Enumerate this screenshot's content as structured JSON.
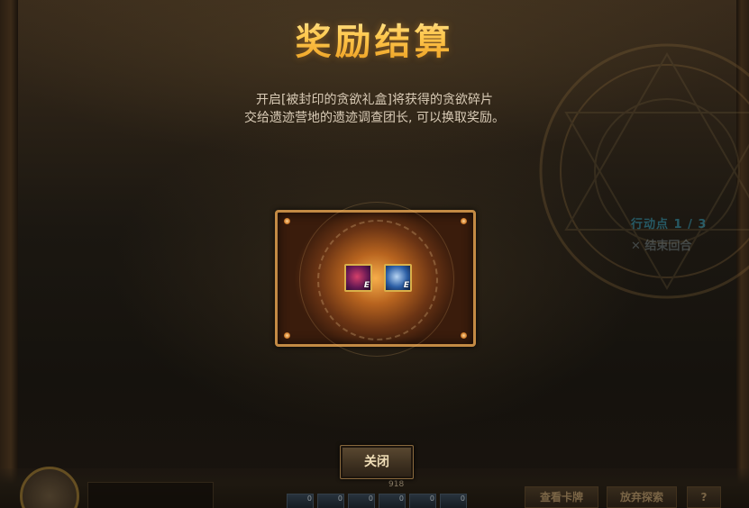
{
  "title": "奖励结算",
  "description": {
    "line1": "开启[被封印的贪欲礼盒]将获得的贪欲碎片",
    "line2": "交给遗迹营地的遗迹调查团长, 可以换取奖励。"
  },
  "rewards": [
    {
      "icon": "crimson-orb-item-icon",
      "tag": "E"
    },
    {
      "icon": "blue-crystal-item-icon",
      "tag": "E"
    }
  ],
  "close_button": "关闭",
  "background_hud": {
    "action_points": "行动点 1 / 3",
    "end_turn": "✕ 结束回合",
    "count": "918",
    "slot_counts": [
      "0",
      "0",
      "0",
      "0",
      "0",
      "0"
    ],
    "check_cards_button": "查看卡牌",
    "give_up_button": "放弃探索",
    "help_button": "?"
  },
  "colors": {
    "title_gold": "#ffd45a",
    "panel_border": "#c38a44",
    "description_text": "#d9cbb6"
  }
}
